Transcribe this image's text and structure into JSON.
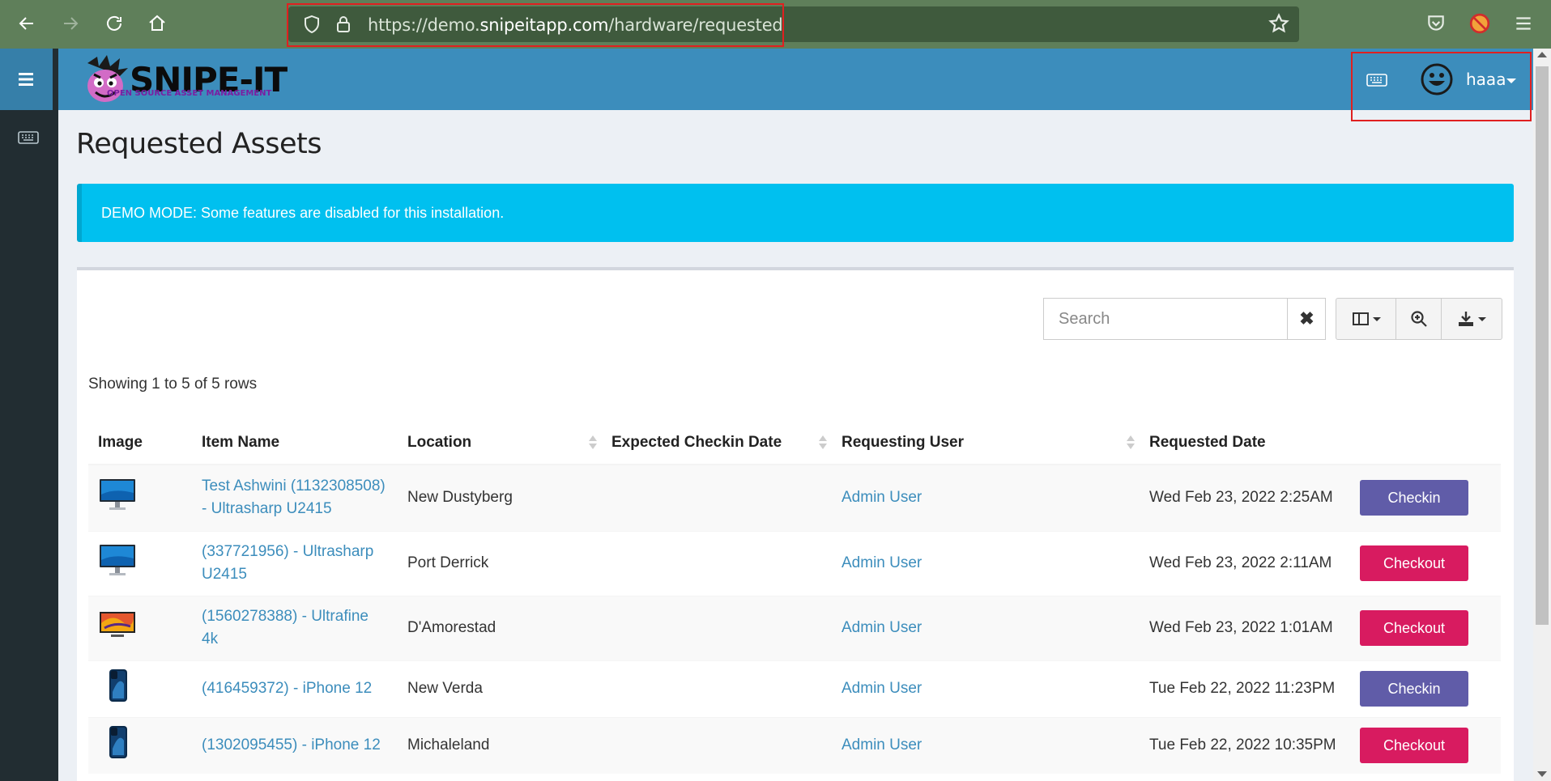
{
  "browser": {
    "url_prefix": "https://demo.",
    "url_domain": "snipeitapp.com",
    "url_path": "/hardware/requested"
  },
  "header": {
    "logo_text": "SNIPE-IT",
    "logo_subtitle": "OPEN SOURCE ASSET MANAGEMENT",
    "username": "haaa"
  },
  "page": {
    "title": "Requested Assets",
    "alert": "DEMO MODE: Some features are disabled for this installation.",
    "search_placeholder": "Search",
    "showing": "Showing 1 to 5 of 5 rows"
  },
  "table": {
    "columns": [
      "Image",
      "Item Name",
      "Location",
      "Expected Checkin Date",
      "Requesting User",
      "Requested Date"
    ],
    "rows": [
      {
        "image": "monitor-dell",
        "item_line1": "Test Ashwini (1132308508)",
        "item_line2": "- Ultrasharp U2415",
        "location": "New Dustyberg",
        "expected": "",
        "user": "Admin User",
        "date": "Wed Feb 23, 2022 2:25AM",
        "action": "Checkin"
      },
      {
        "image": "monitor-dell",
        "item_line1": "(337721956) - Ultrasharp",
        "item_line2": "U2415",
        "location": "Port Derrick",
        "expected": "",
        "user": "Admin User",
        "date": "Wed Feb 23, 2022 2:11AM",
        "action": "Checkout"
      },
      {
        "image": "monitor-lg",
        "item_line1": "(1560278388) - Ultrafine",
        "item_line2": "4k",
        "location": "D'Amorestad",
        "expected": "",
        "user": "Admin User",
        "date": "Wed Feb 23, 2022 1:01AM",
        "action": "Checkout"
      },
      {
        "image": "iphone",
        "item_line1": "(416459372) - iPhone 12",
        "item_line2": "",
        "location": "New Verda",
        "expected": "",
        "user": "Admin User",
        "date": "Tue Feb 22, 2022 11:23PM",
        "action": "Checkin"
      },
      {
        "image": "iphone",
        "item_line1": "(1302095455) - iPhone 12",
        "item_line2": "",
        "location": "Michaleland",
        "expected": "",
        "user": "Admin User",
        "date": "Tue Feb 22, 2022 10:35PM",
        "action": "Checkout"
      }
    ]
  },
  "colors": {
    "header": "#3c8dbc",
    "sidebar": "#222d32",
    "alert": "#00c0ef",
    "checkin": "#605ca8",
    "checkout": "#d81b60",
    "link": "#3c8dbc"
  }
}
